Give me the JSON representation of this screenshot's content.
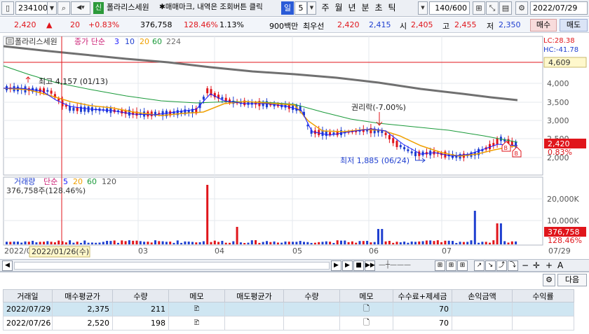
{
  "toolbar": {
    "code": "234100",
    "badge": "신",
    "name": "폴라리스세원",
    "memo_notice": "✱매매마크, 내역은 조회버튼 클릭",
    "period": "일",
    "period_num": "5",
    "periods": [
      "주",
      "월",
      "년",
      "분",
      "초",
      "틱"
    ],
    "count": "140/600",
    "date": "2022/07/29"
  },
  "quote": {
    "price": "2,420",
    "arrow": "▲",
    "change": "20",
    "change_pct": "+0.83%",
    "volume": "376,758",
    "vol_ratio": "128.46%",
    "turnover": "1.13%",
    "amount_label": "900백만",
    "best_label": "최우선",
    "ask": "2,420",
    "bid": "2,415",
    "open_label": "시",
    "open": "2,405",
    "high_label": "고",
    "high": "2,455",
    "low_label": "저",
    "low": "2,350",
    "buy_btn": "매수",
    "sell_btn": "매도"
  },
  "price_panel": {
    "name_tag": "폴라리스세원",
    "ma_label": "종가 단순",
    "ma_periods": [
      "3",
      "10",
      "20",
      "60",
      "224"
    ],
    "lc": "LC:28.38",
    "hc": "HC:-41.78",
    "ref_price": "4,609",
    "y_ticks": [
      "4,000",
      "3,500",
      "3,000",
      "2,500",
      "2,000"
    ],
    "last_price": "2,420",
    "last_pct": "0.83%",
    "annot_high": "최고 4,157 (01/13)",
    "annot_low": "최저 1,885 (06/24)",
    "annot_rights": "권리락(-7.00%)",
    "marker_b": "B"
  },
  "volume_panel": {
    "label": "거래량",
    "ma_label": "단순",
    "ma_periods": [
      "5",
      "20",
      "60",
      "120"
    ],
    "vol_text": "376,758주(128.46%)",
    "y_ticks": [
      "20,000K",
      "10,000K"
    ],
    "last_vol": "376,758",
    "last_pct": "128.46%"
  },
  "xaxis": {
    "start": "2022/0",
    "cursor_date": "2022/01/26(수)",
    "months": [
      "03",
      "04",
      "05",
      "06",
      "07"
    ],
    "end": "07/29"
  },
  "grid": {
    "next_btn": "다음",
    "headers": [
      "거래일",
      "매수평균가",
      "수량",
      "메모",
      "매도평균가",
      "수량",
      "메모",
      "수수료+제세금",
      "손익금액",
      "수익률"
    ],
    "rows": [
      {
        "date": "2022/07/29",
        "buy_avg": "2,375",
        "qty": "211",
        "sell_avg": "",
        "sell_qty": "",
        "fee": "70",
        "pnl": "",
        "ret": ""
      },
      {
        "date": "2022/07/26",
        "buy_avg": "2,520",
        "qty": "198",
        "sell_avg": "",
        "sell_qty": "",
        "fee": "70",
        "pnl": "",
        "ret": ""
      }
    ]
  },
  "colors": {
    "up": "#e0151b",
    "down": "#1f3fd0",
    "ma5": "#1a1aff",
    "ma20": "#f0a000",
    "ma60": "#1a9a3a",
    "ma224": "#777777"
  }
}
